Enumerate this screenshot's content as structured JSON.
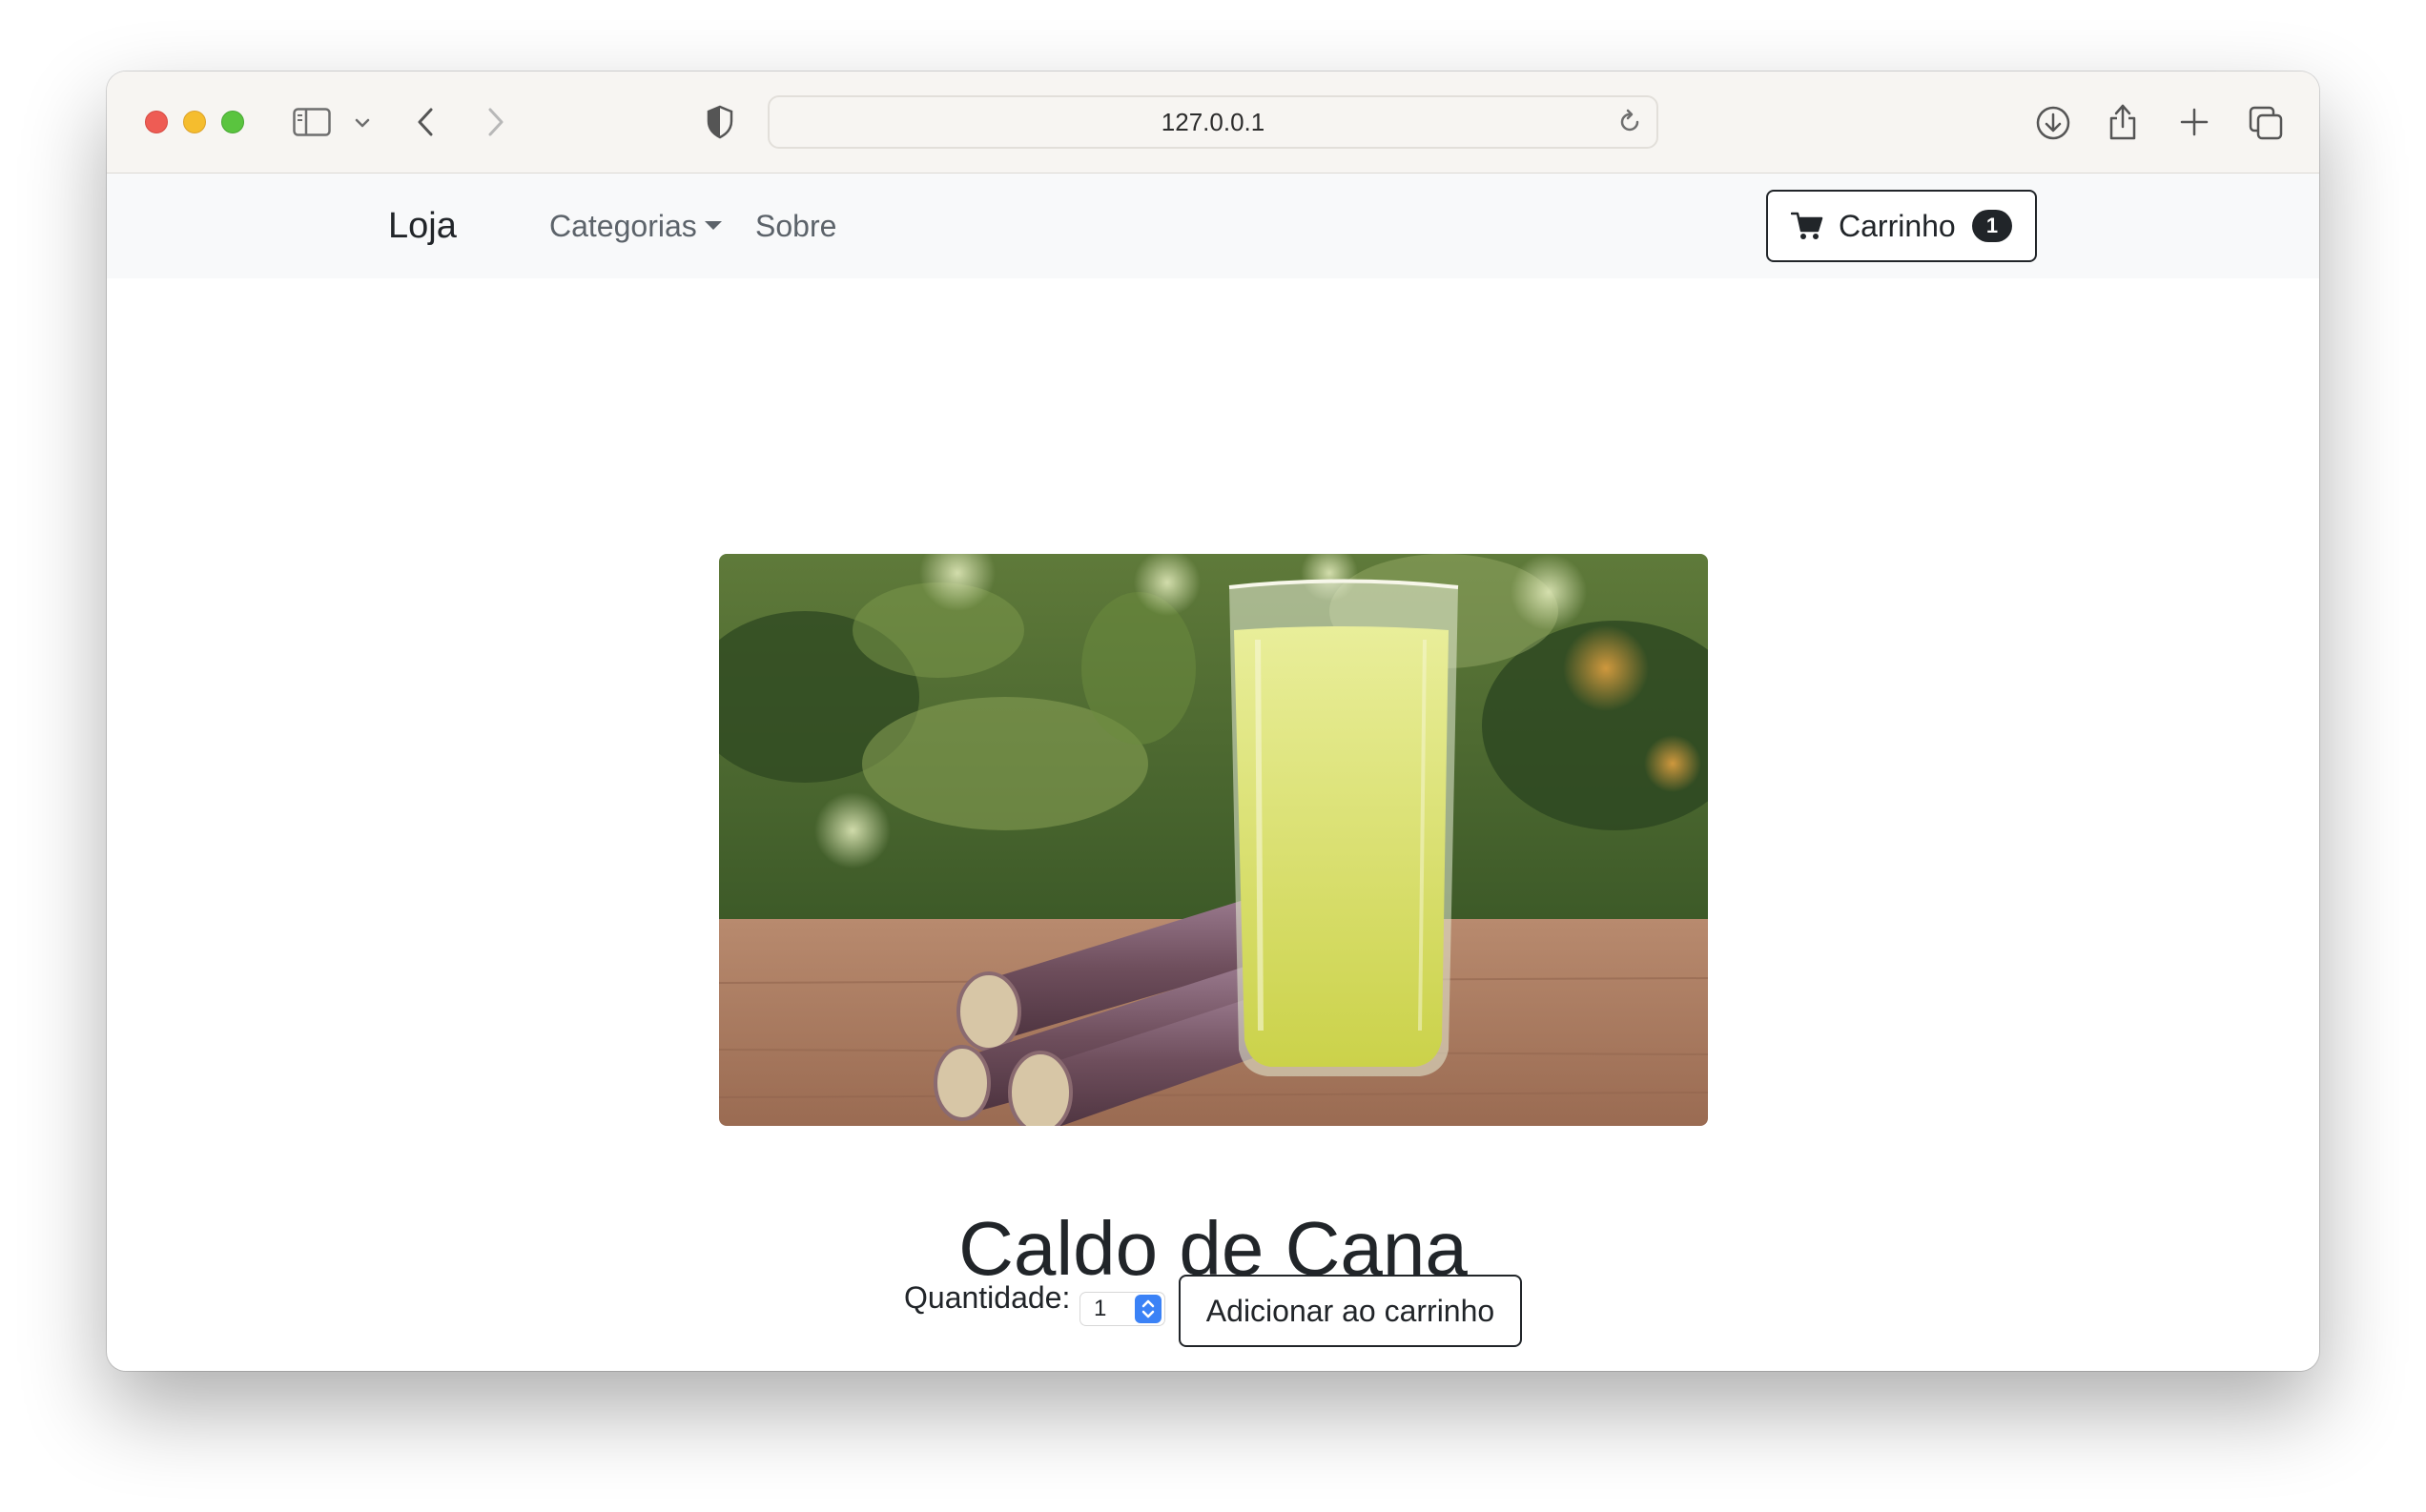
{
  "browser": {
    "url": "127.0.0.1",
    "icons": [
      "sidebar-toggle-icon",
      "chevron-down-icon",
      "back-arrow-icon",
      "forward-arrow-icon",
      "shield-icon",
      "reload-icon",
      "download-icon",
      "share-icon",
      "new-tab-plus-icon",
      "tab-overview-icon"
    ],
    "traffic_light_colors": {
      "close": "#ee5c54",
      "minimize": "#f5bd2e",
      "zoom": "#5ac43f"
    }
  },
  "navbar": {
    "brand": "Loja",
    "links": [
      {
        "label": "Categorias",
        "has_dropdown": true
      },
      {
        "label": "Sobre"
      }
    ],
    "cart": {
      "label": "Carrinho",
      "count": "1",
      "icon": "cart-icon"
    }
  },
  "product": {
    "name": "Caldo de Cana",
    "image_subject": "sugarcane-juice-photo",
    "quantity_label": "Quantidade:",
    "quantity_value": "1",
    "add_button_label": "Adicionar ao carrinho"
  },
  "colors": {
    "text_dark": "#212529",
    "nav_link": "#5c636a",
    "navbar_bg": "#f8f9fa",
    "stepper_accent": "#3b82f6"
  }
}
